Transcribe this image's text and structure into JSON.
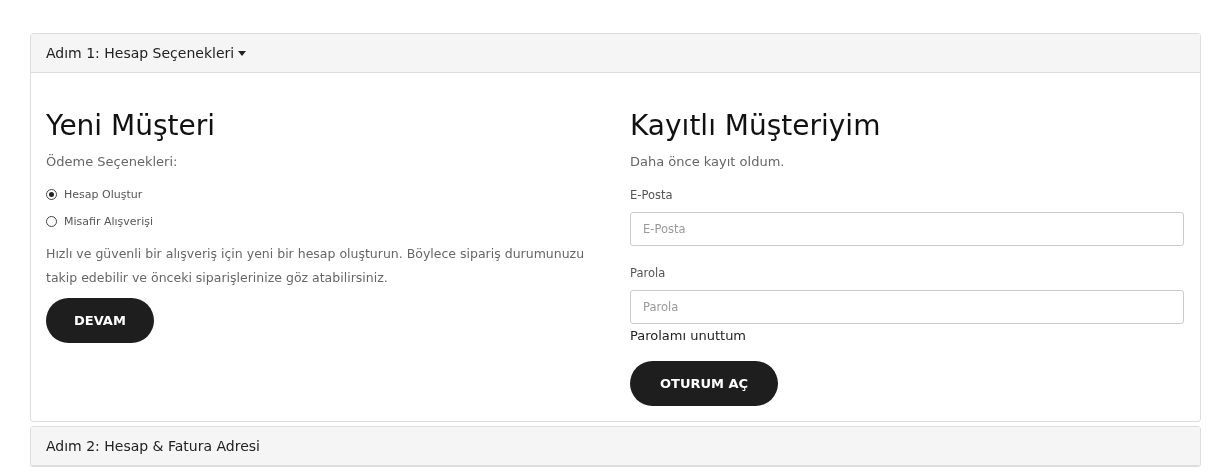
{
  "steps": [
    {
      "title": "Adım 1: Hesap Seçenekleri",
      "expanded": true
    },
    {
      "title": "Adım 2: Hesap & Fatura Adresi",
      "expanded": false
    }
  ],
  "new_customer": {
    "heading": "Yeni Müşteri",
    "subheading": "Ödeme Seçenekleri:",
    "options": [
      {
        "label": "Hesap Oluştur",
        "selected": true
      },
      {
        "label": "Misafir Alışverişi",
        "selected": false
      }
    ],
    "description": "Hızlı ve güvenli bir alışveriş için yeni bir hesap oluşturun. Böylece sipariş durumunuzu takip edebilir ve önceki siparişlerinize göz atabilirsiniz.",
    "button": "DEVAM"
  },
  "returning_customer": {
    "heading": "Kayıtlı Müşteriyim",
    "subheading": "Daha önce kayıt oldum.",
    "fields": [
      {
        "label": "E-Posta",
        "placeholder": "E-Posta"
      },
      {
        "label": "Parola",
        "placeholder": "Parola"
      }
    ],
    "forgot_link": "Parolamı unuttum",
    "button": "OTURUM AÇ"
  }
}
